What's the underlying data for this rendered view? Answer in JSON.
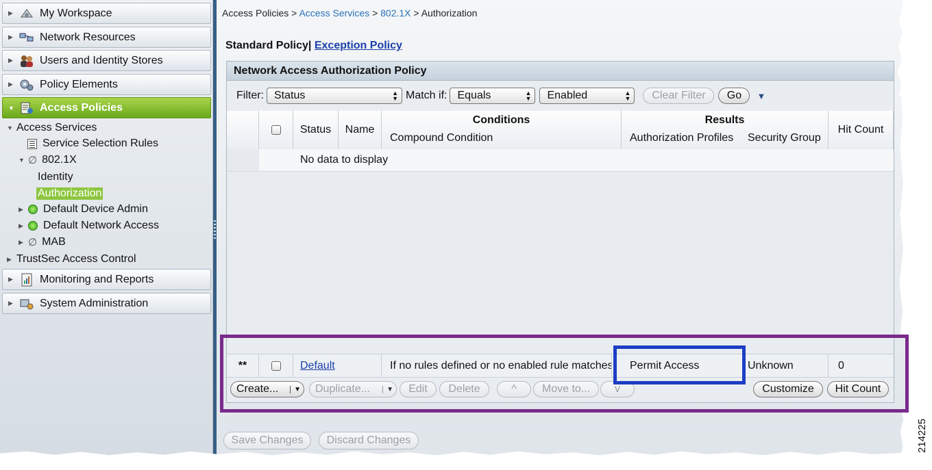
{
  "sidebar": {
    "drawers_top": [
      {
        "label": "My Workspace",
        "icon": "workspace-icon"
      },
      {
        "label": "Network Resources",
        "icon": "network-resources-icon"
      },
      {
        "label": "Users and Identity Stores",
        "icon": "users-icon"
      },
      {
        "label": "Policy Elements",
        "icon": "policy-elements-icon"
      },
      {
        "label": "Access Policies",
        "icon": "access-policies-icon"
      }
    ],
    "tree": {
      "access_services": "Access Services",
      "service_selection_rules": "Service Selection Rules",
      "dot1x": "802.1X",
      "identity": "Identity",
      "authorization": "Authorization",
      "default_device_admin": "Default Device Admin",
      "default_network_access": "Default Network Access",
      "mab": "MAB",
      "trustsec": "TrustSec Access Control"
    },
    "drawers_bottom": [
      {
        "label": "Monitoring and Reports",
        "icon": "monitoring-icon"
      },
      {
        "label": "System Administration",
        "icon": "system-admin-icon"
      }
    ]
  },
  "breadcrumb": {
    "root": "Access Policies",
    "sep": ">",
    "level1": "Access Services",
    "level2": "802.1X",
    "current": "Authorization"
  },
  "policy_tabs": {
    "standard": "Standard Policy|",
    "exception": "Exception Policy"
  },
  "panel": {
    "title": "Network Access Authorization Policy",
    "filter": {
      "filter_label": "Filter:",
      "filter_value": "Status",
      "match_label": "Match if:",
      "match_value": "Equals",
      "value_value": "Enabled",
      "clear_filter": "Clear Filter",
      "go": "Go"
    },
    "columns": {
      "status": "Status",
      "name": "Name",
      "conditions": "Conditions",
      "compound_condition": "Compound Condition",
      "results": "Results",
      "authorization_profiles": "Authorization Profiles",
      "security_group": "Security Group",
      "hit_count": "Hit Count"
    },
    "empty_message": "No data to display",
    "default_rule": {
      "marker": "**",
      "name": "Default",
      "condition": "If no rules defined or no enabled rule matches.",
      "authorization_profile": "Permit Access",
      "security_group": "Unknown",
      "hit_count": "0"
    },
    "actions": {
      "create": "Create...",
      "duplicate": "Duplicate...",
      "edit": "Edit",
      "delete": "Delete",
      "move_up": "^",
      "move_to": "Move to...",
      "move_down": "v",
      "customize": "Customize",
      "hit_count": "Hit Count"
    }
  },
  "footer": {
    "save": "Save Changes",
    "discard": "Discard Changes"
  },
  "figure_number": "214225",
  "colors": {
    "active_drawer": "#8dc63f",
    "link": "#2a73b8",
    "highlight_purple": "#7a2a8c",
    "highlight_blue": "#1d3ec4"
  }
}
